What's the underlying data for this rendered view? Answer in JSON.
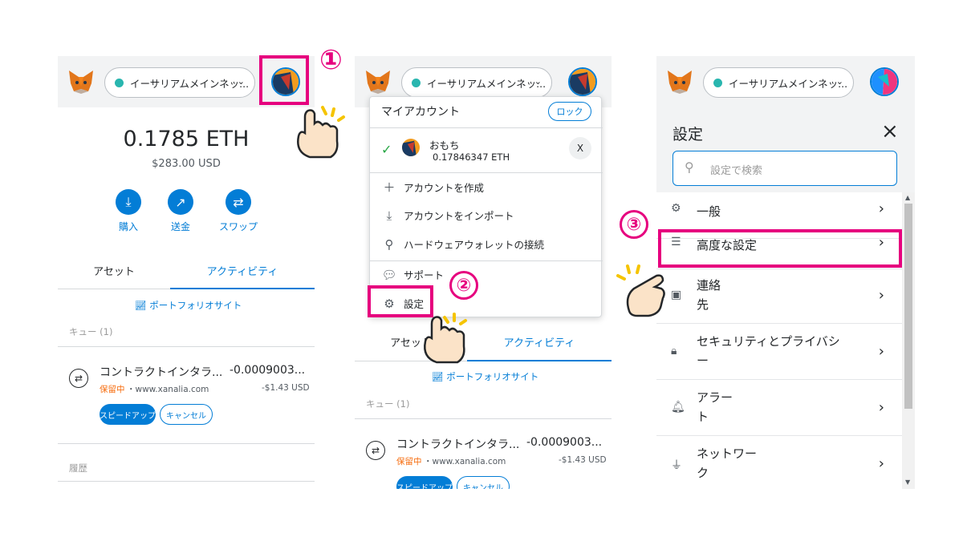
{
  "network": {
    "label": "イーサリアムメインネッ..."
  },
  "panel1": {
    "balance_eth": "0.1785 ETH",
    "balance_usd": "$283.00 USD",
    "actions": [
      {
        "label": "購入",
        "icon": "download-icon"
      },
      {
        "label": "送金",
        "icon": "arrow-up-right-icon"
      },
      {
        "label": "スワップ",
        "icon": "swap-icon"
      }
    ],
    "tabs": [
      "アセット",
      "アクティビティ"
    ],
    "portfolio_link": "ポートフォリオサイト",
    "queue_label": "キュー (1)",
    "tx": {
      "title": "コントラクトインタラ...",
      "amount": "-0.0009003...",
      "status": "保留中",
      "site": "・www.xanalia.com",
      "usd": "-$1.43 USD",
      "speedup": "スピードアップ",
      "cancel": "キャンセル"
    },
    "history_label": "履歴"
  },
  "panel2": {
    "menu_title": "マイアカウント",
    "lock": "ロック",
    "account_name": "おもち",
    "account_balance": "0.17846347 ETH",
    "close": "X",
    "items": [
      "アカウントを作成",
      "アカウントをインポート",
      "ハードウェアウォレットの接続",
      "サポート",
      "設定"
    ],
    "tabs": [
      "アセット",
      "アクティビティ"
    ],
    "portfolio_link": "ポートフォリオサイト",
    "queue_label": "キュー (1)",
    "tx": {
      "title": "コントラクトインタラ...",
      "amount": "-0.0009003...",
      "status": "保留中",
      "site": "・www.xanalia.com",
      "usd": "-$1.43 USD",
      "speedup": "スピードアップ",
      "cancel": "キャンセル"
    }
  },
  "panel3": {
    "title": "設定",
    "close": "×",
    "search_placeholder": "設定で検索",
    "rows": [
      {
        "label": "一般",
        "icon": "gear-icon"
      },
      {
        "label": "高度な設定",
        "icon": "sliders-icon"
      },
      {
        "label": "連絡\n先",
        "icon": "contact-book-icon"
      },
      {
        "label": "セキュリティとプライバシ\nー",
        "icon": "lock-icon"
      },
      {
        "label": "アラー\nト",
        "icon": "bell-icon"
      },
      {
        "label": "ネットワー\nク",
        "icon": "plug-icon"
      }
    ]
  },
  "steps": [
    "①",
    "②",
    "③"
  ],
  "colors": {
    "accent": "#037dd6",
    "highlight": "#e6007e",
    "pending": "#f66a0a",
    "header_bg": "#f2f3f4"
  }
}
